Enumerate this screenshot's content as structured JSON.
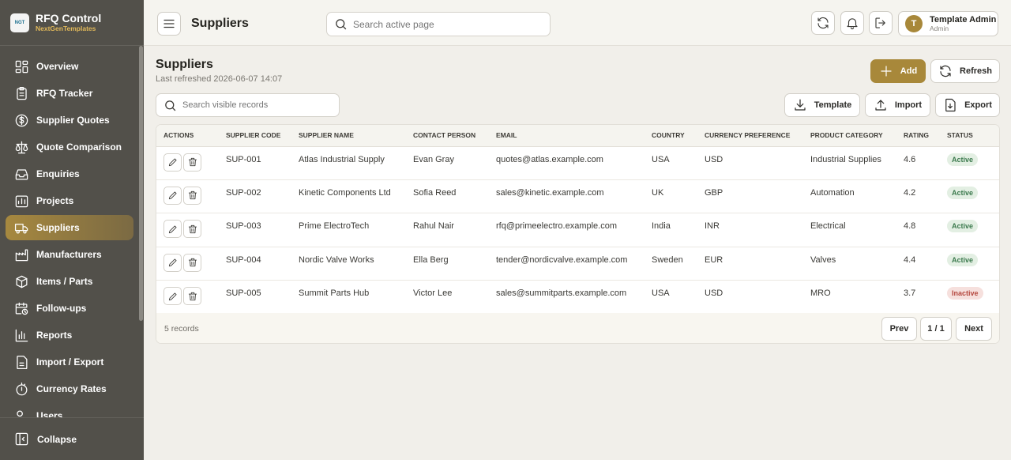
{
  "brand": {
    "logo_text": "NGT",
    "title": "RFQ Control",
    "subtitle": "NextGenTemplates"
  },
  "sidebar": {
    "items": [
      {
        "label": "Overview",
        "icon": "grid-icon",
        "active": false
      },
      {
        "label": "RFQ Tracker",
        "icon": "clipboard-icon",
        "active": false
      },
      {
        "label": "Supplier Quotes",
        "icon": "dollar-icon",
        "active": false
      },
      {
        "label": "Quote Comparison",
        "icon": "scale-icon",
        "active": false
      },
      {
        "label": "Enquiries",
        "icon": "inbox-icon",
        "active": false
      },
      {
        "label": "Projects",
        "icon": "projects-icon",
        "active": false
      },
      {
        "label": "Suppliers",
        "icon": "truck-icon",
        "active": true
      },
      {
        "label": "Manufacturers",
        "icon": "factory-icon",
        "active": false
      },
      {
        "label": "Items / Parts",
        "icon": "boxes-icon",
        "active": false
      },
      {
        "label": "Follow-ups",
        "icon": "calendar-clock-icon",
        "active": false
      },
      {
        "label": "Reports",
        "icon": "bar-chart-icon",
        "active": false
      },
      {
        "label": "Import / Export",
        "icon": "file-icon",
        "active": false
      },
      {
        "label": "Currency Rates",
        "icon": "currency-icon",
        "active": false
      },
      {
        "label": "Users",
        "icon": "users-icon",
        "active": false
      }
    ],
    "collapse_label": "Collapse"
  },
  "header": {
    "title": "Suppliers",
    "search_placeholder": "Search active page",
    "user": {
      "initial": "T",
      "name": "Template Admin",
      "role": "Admin"
    }
  },
  "main": {
    "title": "Suppliers",
    "subtitle": "Last refreshed 2026-06-07 14:07",
    "buttons": {
      "add": "Add",
      "refresh": "Refresh",
      "template": "Template",
      "import": "Import",
      "export": "Export"
    },
    "table_search_placeholder": "Search visible records",
    "columns": [
      "ACTIONS",
      "SUPPLIER CODE",
      "SUPPLIER NAME",
      "CONTACT PERSON",
      "EMAIL",
      "COUNTRY",
      "CURRENCY PREFERENCE",
      "PRODUCT CATEGORY",
      "RATING",
      "STATUS"
    ],
    "rows": [
      {
        "code": "SUP-001",
        "name": "Atlas Industrial Supply",
        "contact": "Evan Gray",
        "email": "quotes@atlas.example.com",
        "country": "USA",
        "currency": "USD",
        "category": "Industrial Supplies",
        "rating": "4.6",
        "status": "Active"
      },
      {
        "code": "SUP-002",
        "name": "Kinetic Components Ltd",
        "contact": "Sofia Reed",
        "email": "sales@kinetic.example.com",
        "country": "UK",
        "currency": "GBP",
        "category": "Automation",
        "rating": "4.2",
        "status": "Active"
      },
      {
        "code": "SUP-003",
        "name": "Prime ElectroTech",
        "contact": "Rahul Nair",
        "email": "rfq@primeelectro.example.com",
        "country": "India",
        "currency": "INR",
        "category": "Electrical",
        "rating": "4.8",
        "status": "Active"
      },
      {
        "code": "SUP-004",
        "name": "Nordic Valve Works",
        "contact": "Ella Berg",
        "email": "tender@nordicvalve.example.com",
        "country": "Sweden",
        "currency": "EUR",
        "category": "Valves",
        "rating": "4.4",
        "status": "Active"
      },
      {
        "code": "SUP-005",
        "name": "Summit Parts Hub",
        "contact": "Victor Lee",
        "email": "sales@summitparts.example.com",
        "country": "USA",
        "currency": "USD",
        "category": "MRO",
        "rating": "3.7",
        "status": "Inactive"
      }
    ],
    "footer": {
      "count": "5 records",
      "prev": "Prev",
      "page": "1 / 1",
      "next": "Next"
    }
  },
  "colors": {
    "accent": "#a8883a",
    "sidebar_bg": "#52504a",
    "active_status": "#3c7a4e",
    "inactive_status": "#b5483f"
  }
}
